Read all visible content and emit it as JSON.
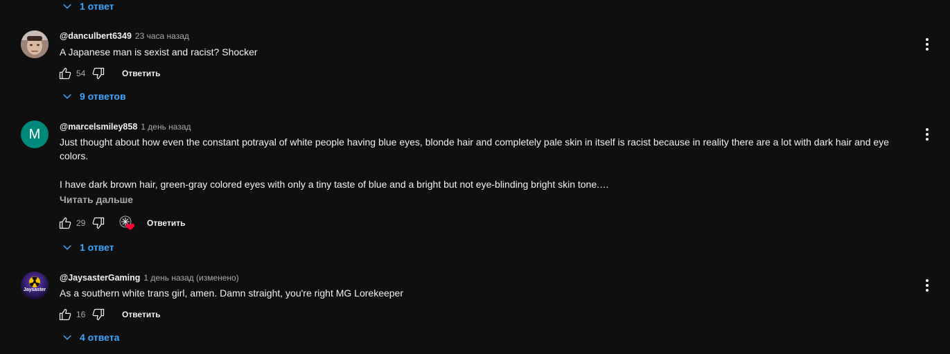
{
  "top_replies": {
    "label": "1 ответ"
  },
  "comments": [
    {
      "author": "@danculbert6349",
      "timestamp": "23 часа назад",
      "text": "A Japanese man is sexist and racist? Shocker",
      "likes": "54",
      "reply_label": "Ответить",
      "replies_label": "9 ответов"
    },
    {
      "author": "@marcelsmiley858",
      "timestamp": "1 день назад",
      "avatar_letter": "M",
      "text_p1": "Just thought about how even the constant potrayal of white people having blue eyes, blonde hair and completely pale skin in itself is racist because in reality there are a lot with dark hair and eye colors.",
      "text_p2": "I have dark brown hair, green-gray colored eyes with only a tiny taste of blue and a bright but not eye-blinding bright skin tone.…",
      "read_more": "Читать дальше",
      "likes": "29",
      "reply_label": "Ответить",
      "replies_label": "1 ответ"
    },
    {
      "author": "@JaysasterGaming",
      "timestamp": "1 день назад (изменено)",
      "avatar_text": "Jaysaster",
      "text": "As a southern white trans girl, amen. Damn straight, you're right MG Lorekeeper",
      "likes": "16",
      "reply_label": "Ответить",
      "replies_label": "4 ответа"
    }
  ],
  "colors": {
    "background": "#0f0f0f",
    "link_blue": "#3ea6ff",
    "secondary_text": "#aaaaaa",
    "avatar_teal": "#00897b",
    "heart_red": "#ff0033"
  }
}
